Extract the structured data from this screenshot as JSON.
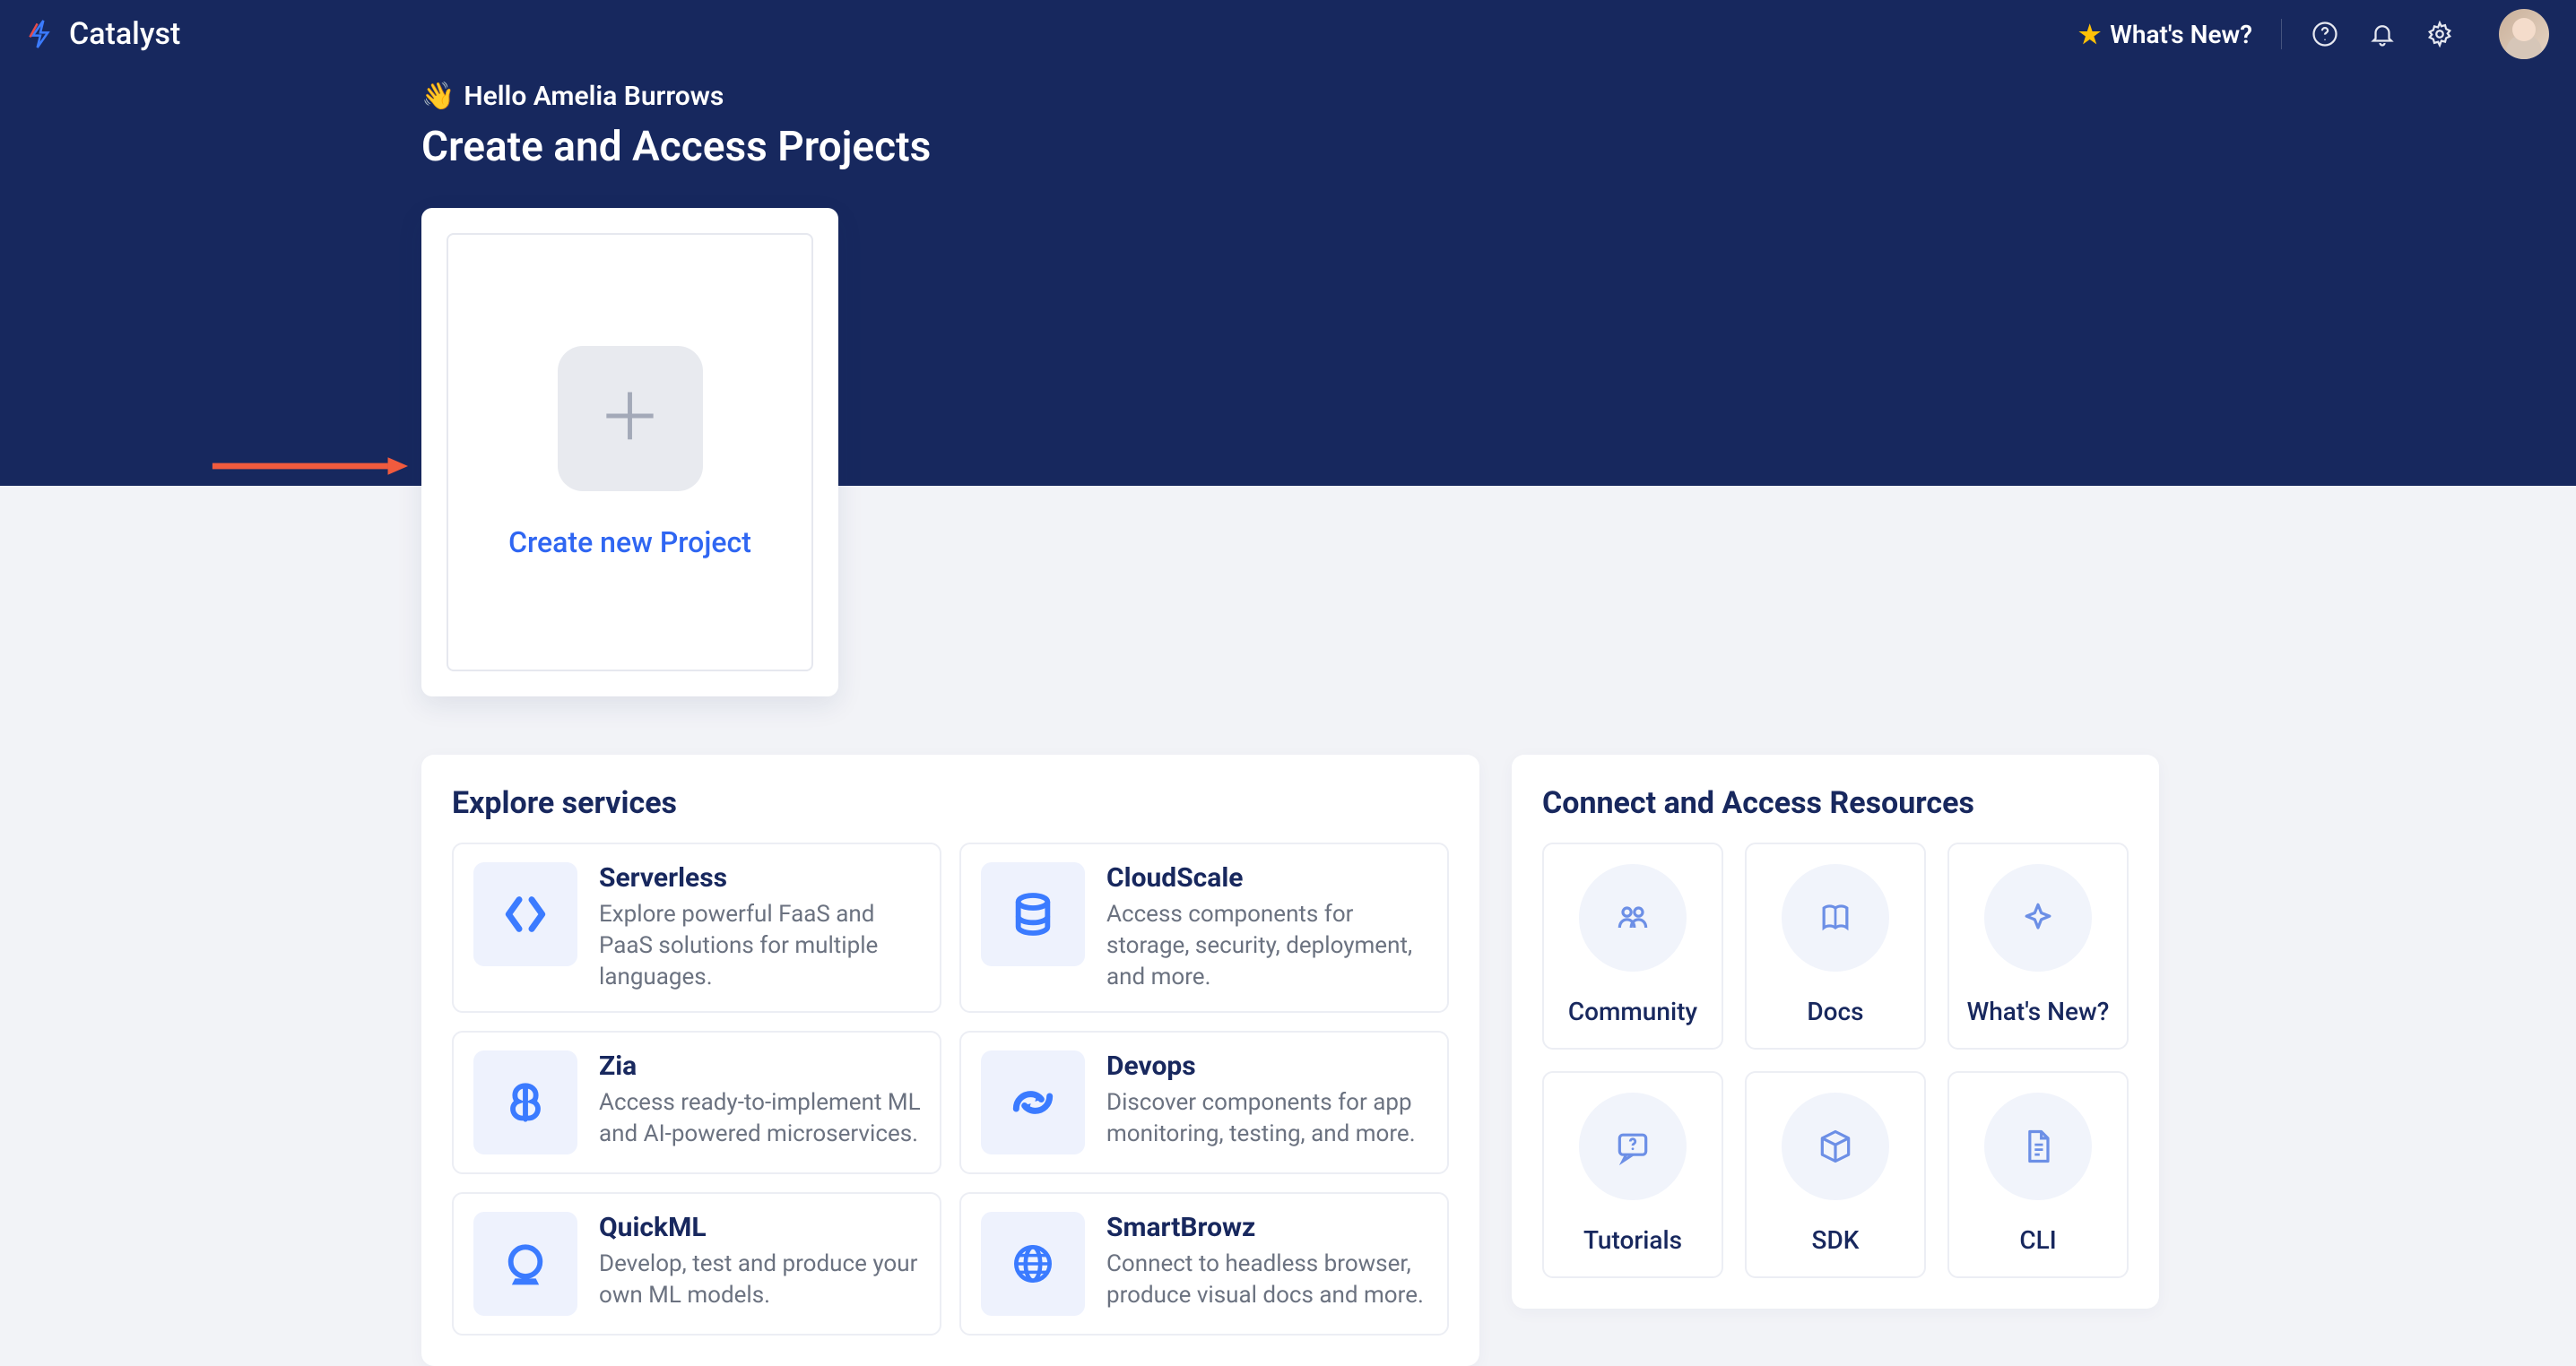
{
  "brand": {
    "name": "Catalyst"
  },
  "topbar": {
    "whats_new": "What's New?"
  },
  "hero": {
    "greeting_emoji": "👋",
    "greeting": "Hello Amelia Burrows",
    "title": "Create and Access Projects",
    "create_label": "Create new Project"
  },
  "explore": {
    "title": "Explore services",
    "services": [
      {
        "title": "Serverless",
        "desc": "Explore powerful FaaS and PaaS solutions for multiple languages.",
        "icon": "code-icon"
      },
      {
        "title": "CloudScale",
        "desc": "Access components for storage, security, deployment, and more.",
        "icon": "database-icon"
      },
      {
        "title": "Zia",
        "desc": "Access ready-to-implement ML and AI-powered microservices.",
        "icon": "brain-icon"
      },
      {
        "title": "Devops",
        "desc": "Discover components for app monitoring, testing, and more.",
        "icon": "devops-icon"
      },
      {
        "title": "QuickML",
        "desc": "Develop, test and produce your own ML models.",
        "icon": "crystal-ball-icon"
      },
      {
        "title": "SmartBrowz",
        "desc": "Connect to headless browser, produce visual docs and more.",
        "icon": "globe-icon"
      }
    ]
  },
  "resources": {
    "title": "Connect and Access Resources",
    "items": [
      {
        "label": "Community",
        "icon": "community-icon"
      },
      {
        "label": "Docs",
        "icon": "book-icon"
      },
      {
        "label": "What's New?",
        "icon": "sparkle-icon"
      },
      {
        "label": "Tutorials",
        "icon": "chat-help-icon"
      },
      {
        "label": "SDK",
        "icon": "package-icon"
      },
      {
        "label": "CLI",
        "icon": "file-code-icon"
      }
    ]
  }
}
